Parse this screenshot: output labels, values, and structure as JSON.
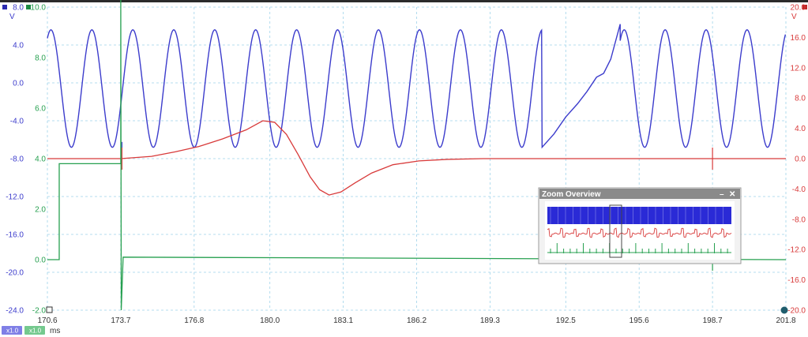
{
  "chart_data": {
    "type": "line",
    "x_unit": "ms",
    "xlim": [
      170.6,
      201.8
    ],
    "x_ticks": [
      "170.6",
      "173.7",
      "176.8",
      "180.0",
      "183.1",
      "186.2",
      "189.3",
      "192.5",
      "195.6",
      "198.7",
      "201.8"
    ],
    "axes": {
      "blue": {
        "unit": "V",
        "ylim": [
          -24.0,
          8.0
        ],
        "ticks": [
          "8.0",
          "4.0",
          "0.0",
          "-4.0",
          "-8.0",
          "-12.0",
          "-16.0",
          "-20.0",
          "-24.0"
        ],
        "color": "#3c3ccc"
      },
      "red": {
        "unit": "V",
        "ylim": [
          -20.0,
          20.0
        ],
        "ticks": [
          "20.0",
          "16.0",
          "12.0",
          "8.0",
          "4.0",
          "0.0",
          "-4.0",
          "-8.0",
          "-12.0",
          "-16.0",
          "-20.0"
        ],
        "color": "#d83a3a"
      },
      "green": {
        "unit": "V",
        "ylim": [
          -2.0,
          10.0
        ],
        "ticks": [
          "10.0",
          "8.0",
          "6.0",
          "4.0",
          "2.0",
          "0.0",
          "-2.0"
        ],
        "color": "#27a050"
      }
    },
    "series": [
      {
        "channel": "blue",
        "color": "#3c3ccc",
        "shape": "sine",
        "center": -0.6,
        "amplitude": 6.2,
        "period_ms": 1.73,
        "phase_ms": 170.75,
        "flat_segment": {
          "start_ms": 191.5,
          "end_ms": 194.8,
          "points": [
            [
              191.5,
              -6.8
            ],
            [
              192.0,
              -5.4
            ],
            [
              192.5,
              -3.6
            ],
            [
              193.0,
              -2.2
            ],
            [
              193.4,
              -0.9
            ],
            [
              193.8,
              0.6
            ],
            [
              194.1,
              1.0
            ],
            [
              194.4,
              2.5
            ],
            [
              194.8,
              6.2
            ]
          ]
        },
        "glitches": [
          {
            "x": 173.75,
            "y": -7.4
          }
        ]
      },
      {
        "channel": "red",
        "color": "#d83a3a",
        "points": [
          [
            170.6,
            0.0
          ],
          [
            173.7,
            0.0
          ],
          [
            175.0,
            0.3
          ],
          [
            176.0,
            0.9
          ],
          [
            177.0,
            1.6
          ],
          [
            178.0,
            2.6
          ],
          [
            179.0,
            3.8
          ],
          [
            179.7,
            5.0
          ],
          [
            180.2,
            4.8
          ],
          [
            180.7,
            3.2
          ],
          [
            181.2,
            0.5
          ],
          [
            181.7,
            -2.4
          ],
          [
            182.1,
            -4.1
          ],
          [
            182.5,
            -4.8
          ],
          [
            183.0,
            -4.4
          ],
          [
            183.6,
            -3.2
          ],
          [
            184.3,
            -1.9
          ],
          [
            185.2,
            -0.8
          ],
          [
            186.3,
            -0.3
          ],
          [
            187.5,
            -0.1
          ],
          [
            189.0,
            0.0
          ],
          [
            201.8,
            0.0
          ]
        ],
        "glitches": [
          {
            "x": 173.75,
            "y": 0.0
          },
          {
            "x": 198.7,
            "y": 0.0
          }
        ]
      },
      {
        "channel": "green",
        "color": "#27a050",
        "points": [
          [
            170.6,
            0.0
          ],
          [
            171.1,
            0.0
          ],
          [
            171.1,
            3.8
          ],
          [
            173.7,
            3.8
          ],
          [
            173.7,
            10.3
          ],
          [
            173.72,
            -2.0
          ],
          [
            173.8,
            0.1
          ],
          [
            201.8,
            0.0
          ]
        ],
        "glitches": [
          {
            "x": 198.7,
            "y": 0.0
          }
        ]
      }
    ]
  },
  "channel_badges": [
    {
      "label": "x1.0",
      "color": "#7f7fe6"
    },
    {
      "label": "x1.0",
      "color": "#74c98e"
    }
  ],
  "zoom_overview": {
    "title": "Zoom Overview",
    "minimize_glyph": "–",
    "close_glyph": "✕"
  },
  "icons": [
    "blue-channel-marker-icon",
    "green-channel-marker-icon",
    "red-channel-marker-icon",
    "ruler-start-handle-icon",
    "ruler-end-handle-icon"
  ]
}
